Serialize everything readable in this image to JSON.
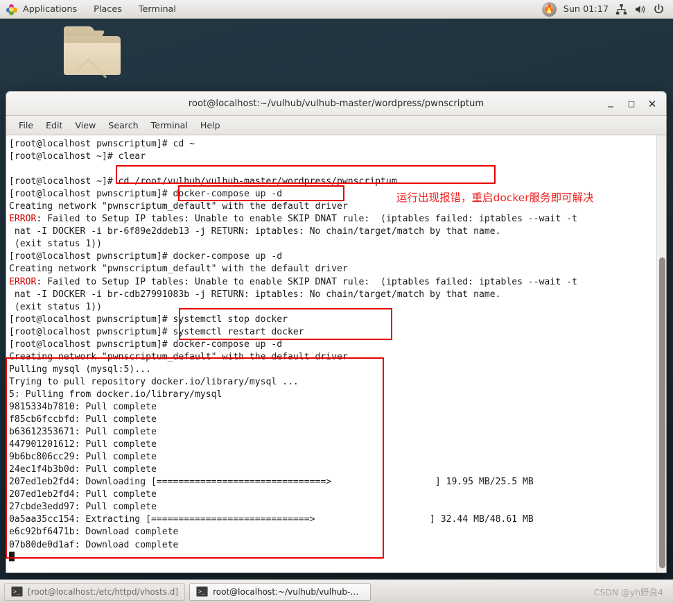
{
  "top_panel": {
    "apps_icon": "applications-icon",
    "items": [
      "Applications",
      "Places",
      "Terminal"
    ],
    "clock": "Sun 01:17",
    "tray": {
      "fire_icon": "firefox-icon",
      "network_icon": "network-icon",
      "volume_icon": "volume-icon",
      "power_icon": "power-icon"
    }
  },
  "desktop": {
    "folder_icon": "folder-icon"
  },
  "window": {
    "title": "root@localhost:~/vulhub/vulhub-master/wordpress/pwnscriptum",
    "buttons": {
      "minimize": "_",
      "maximize": "□",
      "close": "✕"
    },
    "menu": [
      "File",
      "Edit",
      "View",
      "Search",
      "Terminal",
      "Help"
    ]
  },
  "terminal": {
    "lines": [
      {
        "text": "[root@localhost pwnscriptum]# cd ~"
      },
      {
        "text": "[root@localhost ~]# clear"
      },
      {
        "text": ""
      },
      {
        "text": "[root@localhost ~]# cd /root/vulhub/vulhub-master/wordpress/pwnscriptum"
      },
      {
        "text": "[root@localhost pwnscriptum]# docker-compose up -d"
      },
      {
        "text": "Creating network \"pwnscriptum_default\" with the default driver"
      },
      {
        "error_prefix": "ERROR",
        "text": ": Failed to Setup IP tables: Unable to enable SKIP DNAT rule:  (iptables failed: iptables --wait -t"
      },
      {
        "text": " nat -I DOCKER -i br-6f89e2ddeb13 -j RETURN: iptables: No chain/target/match by that name."
      },
      {
        "text": " (exit status 1))"
      },
      {
        "text": "[root@localhost pwnscriptum]# docker-compose up -d"
      },
      {
        "text": "Creating network \"pwnscriptum_default\" with the default driver"
      },
      {
        "error_prefix": "ERROR",
        "text": ": Failed to Setup IP tables: Unable to enable SKIP DNAT rule:  (iptables failed: iptables --wait -t"
      },
      {
        "text": " nat -I DOCKER -i br-cdb27991083b -j RETURN: iptables: No chain/target/match by that name."
      },
      {
        "text": " (exit status 1))"
      },
      {
        "text": "[root@localhost pwnscriptum]# systemctl stop docker"
      },
      {
        "text": "[root@localhost pwnscriptum]# systemctl restart docker"
      },
      {
        "text": "[root@localhost pwnscriptum]# docker-compose up -d"
      },
      {
        "text": "Creating network \"pwnscriptum_default\" with the default driver"
      },
      {
        "text": "Pulling mysql (mysql:5)..."
      },
      {
        "text": "Trying to pull repository docker.io/library/mysql ..."
      },
      {
        "text": "5: Pulling from docker.io/library/mysql"
      },
      {
        "text": "9815334b7810: Pull complete"
      },
      {
        "text": "f85cb6fccbfd: Pull complete"
      },
      {
        "text": "b63612353671: Pull complete"
      },
      {
        "text": "447901201612: Pull complete"
      },
      {
        "text": "9b6bc806cc29: Pull complete"
      },
      {
        "text": "24ec1f4b3b0d: Pull complete"
      },
      {
        "text": "207ed1eb2fd4: Downloading [===============================>                   ] 19.95 MB/25.5 MB"
      },
      {
        "text": "207ed1eb2fd4: Pull complete"
      },
      {
        "text": "27cbde3edd97: Pull complete"
      },
      {
        "text": "0a5aa35cc154: Extracting [=============================>                     ] 32.44 MB/48.61 MB"
      },
      {
        "text": "e6c92bf6471b: Download complete"
      },
      {
        "text": "07b80de0d1af: Download complete"
      },
      {
        "text": "",
        "cursor": true
      }
    ]
  },
  "annotations": {
    "note_text": "运行出现报错，重启docker服务即可解决",
    "accent_color": "#e60000"
  },
  "taskbar": {
    "tasks": [
      {
        "label": "[root@localhost:/etc/httpd/vhosts.d]",
        "icon": "terminal-icon",
        "active": false
      },
      {
        "label": "root@localhost:~/vulhub/vulhub-ma...",
        "icon": "terminal-icon",
        "active": true
      }
    ],
    "watermark": "CSDN @yh野良4"
  }
}
